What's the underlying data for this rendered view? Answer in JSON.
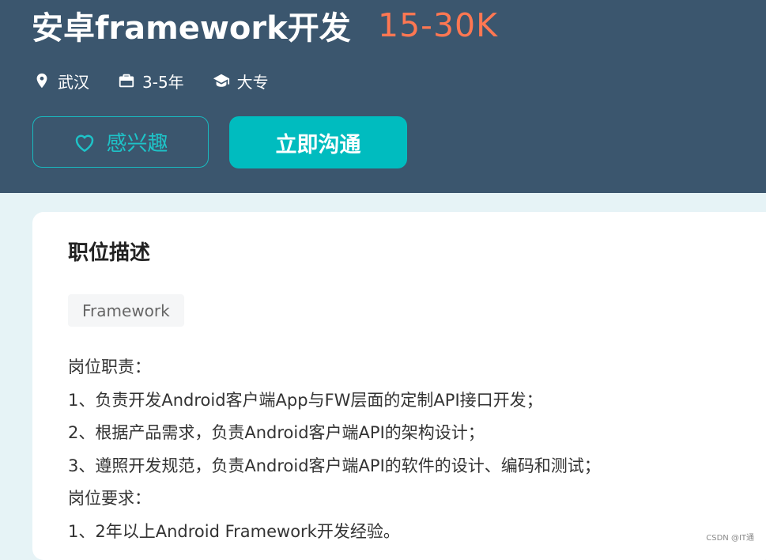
{
  "job": {
    "title": "安卓framework开发",
    "salary": "15-30K",
    "location": "武汉",
    "experience": "3-5年",
    "education": "大专"
  },
  "actions": {
    "interest_label": "感兴趣",
    "chat_label": "立即沟通"
  },
  "description": {
    "section_title": "职位描述",
    "tag": "Framework",
    "lines": [
      "岗位职责：",
      "1、负责开发Android客户端App与FW层面的定制API接口开发；",
      "2、根据产品需求，负责Android客户端API的架构设计；",
      "3、遵照开发规范，负责Android客户端API的软件的设计、编码和测试；",
      "岗位要求：",
      "1、2年以上Android Framework开发经验。"
    ]
  },
  "icons": {
    "location": "location-pin-icon",
    "experience": "briefcase-icon",
    "education": "graduation-cap-icon",
    "interest": "heart-outline-icon"
  },
  "colors": {
    "header_bg": "#3b566e",
    "salary": "#fe7752",
    "accent": "#00bcbf",
    "page_bg": "#e6f3f6"
  },
  "watermark": "CSDN @IT通"
}
